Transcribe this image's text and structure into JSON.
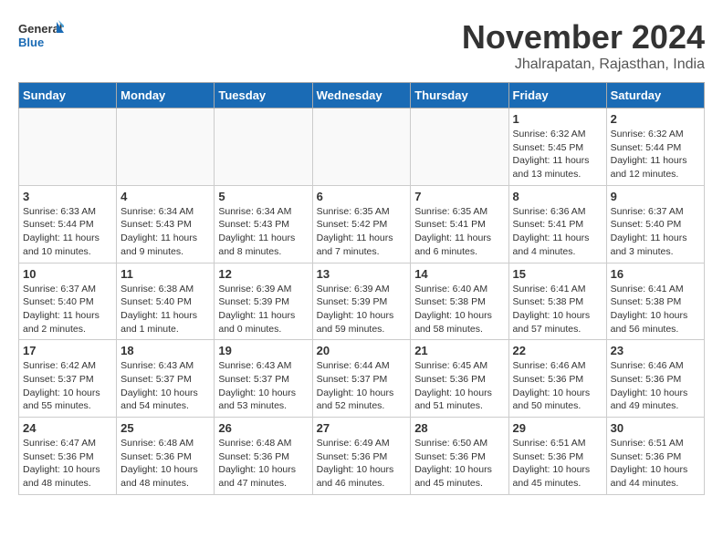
{
  "logo": {
    "line1": "General",
    "line2": "Blue"
  },
  "title": "November 2024",
  "location": "Jhalrapatan, Rajasthan, India",
  "days_of_week": [
    "Sunday",
    "Monday",
    "Tuesday",
    "Wednesday",
    "Thursday",
    "Friday",
    "Saturday"
  ],
  "weeks": [
    [
      {
        "day": "",
        "info": ""
      },
      {
        "day": "",
        "info": ""
      },
      {
        "day": "",
        "info": ""
      },
      {
        "day": "",
        "info": ""
      },
      {
        "day": "",
        "info": ""
      },
      {
        "day": "1",
        "info": "Sunrise: 6:32 AM\nSunset: 5:45 PM\nDaylight: 11 hours and 13 minutes."
      },
      {
        "day": "2",
        "info": "Sunrise: 6:32 AM\nSunset: 5:44 PM\nDaylight: 11 hours and 12 minutes."
      }
    ],
    [
      {
        "day": "3",
        "info": "Sunrise: 6:33 AM\nSunset: 5:44 PM\nDaylight: 11 hours and 10 minutes."
      },
      {
        "day": "4",
        "info": "Sunrise: 6:34 AM\nSunset: 5:43 PM\nDaylight: 11 hours and 9 minutes."
      },
      {
        "day": "5",
        "info": "Sunrise: 6:34 AM\nSunset: 5:43 PM\nDaylight: 11 hours and 8 minutes."
      },
      {
        "day": "6",
        "info": "Sunrise: 6:35 AM\nSunset: 5:42 PM\nDaylight: 11 hours and 7 minutes."
      },
      {
        "day": "7",
        "info": "Sunrise: 6:35 AM\nSunset: 5:41 PM\nDaylight: 11 hours and 6 minutes."
      },
      {
        "day": "8",
        "info": "Sunrise: 6:36 AM\nSunset: 5:41 PM\nDaylight: 11 hours and 4 minutes."
      },
      {
        "day": "9",
        "info": "Sunrise: 6:37 AM\nSunset: 5:40 PM\nDaylight: 11 hours and 3 minutes."
      }
    ],
    [
      {
        "day": "10",
        "info": "Sunrise: 6:37 AM\nSunset: 5:40 PM\nDaylight: 11 hours and 2 minutes."
      },
      {
        "day": "11",
        "info": "Sunrise: 6:38 AM\nSunset: 5:40 PM\nDaylight: 11 hours and 1 minute."
      },
      {
        "day": "12",
        "info": "Sunrise: 6:39 AM\nSunset: 5:39 PM\nDaylight: 11 hours and 0 minutes."
      },
      {
        "day": "13",
        "info": "Sunrise: 6:39 AM\nSunset: 5:39 PM\nDaylight: 10 hours and 59 minutes."
      },
      {
        "day": "14",
        "info": "Sunrise: 6:40 AM\nSunset: 5:38 PM\nDaylight: 10 hours and 58 minutes."
      },
      {
        "day": "15",
        "info": "Sunrise: 6:41 AM\nSunset: 5:38 PM\nDaylight: 10 hours and 57 minutes."
      },
      {
        "day": "16",
        "info": "Sunrise: 6:41 AM\nSunset: 5:38 PM\nDaylight: 10 hours and 56 minutes."
      }
    ],
    [
      {
        "day": "17",
        "info": "Sunrise: 6:42 AM\nSunset: 5:37 PM\nDaylight: 10 hours and 55 minutes."
      },
      {
        "day": "18",
        "info": "Sunrise: 6:43 AM\nSunset: 5:37 PM\nDaylight: 10 hours and 54 minutes."
      },
      {
        "day": "19",
        "info": "Sunrise: 6:43 AM\nSunset: 5:37 PM\nDaylight: 10 hours and 53 minutes."
      },
      {
        "day": "20",
        "info": "Sunrise: 6:44 AM\nSunset: 5:37 PM\nDaylight: 10 hours and 52 minutes."
      },
      {
        "day": "21",
        "info": "Sunrise: 6:45 AM\nSunset: 5:36 PM\nDaylight: 10 hours and 51 minutes."
      },
      {
        "day": "22",
        "info": "Sunrise: 6:46 AM\nSunset: 5:36 PM\nDaylight: 10 hours and 50 minutes."
      },
      {
        "day": "23",
        "info": "Sunrise: 6:46 AM\nSunset: 5:36 PM\nDaylight: 10 hours and 49 minutes."
      }
    ],
    [
      {
        "day": "24",
        "info": "Sunrise: 6:47 AM\nSunset: 5:36 PM\nDaylight: 10 hours and 48 minutes."
      },
      {
        "day": "25",
        "info": "Sunrise: 6:48 AM\nSunset: 5:36 PM\nDaylight: 10 hours and 48 minutes."
      },
      {
        "day": "26",
        "info": "Sunrise: 6:48 AM\nSunset: 5:36 PM\nDaylight: 10 hours and 47 minutes."
      },
      {
        "day": "27",
        "info": "Sunrise: 6:49 AM\nSunset: 5:36 PM\nDaylight: 10 hours and 46 minutes."
      },
      {
        "day": "28",
        "info": "Sunrise: 6:50 AM\nSunset: 5:36 PM\nDaylight: 10 hours and 45 minutes."
      },
      {
        "day": "29",
        "info": "Sunrise: 6:51 AM\nSunset: 5:36 PM\nDaylight: 10 hours and 45 minutes."
      },
      {
        "day": "30",
        "info": "Sunrise: 6:51 AM\nSunset: 5:36 PM\nDaylight: 10 hours and 44 minutes."
      }
    ]
  ]
}
